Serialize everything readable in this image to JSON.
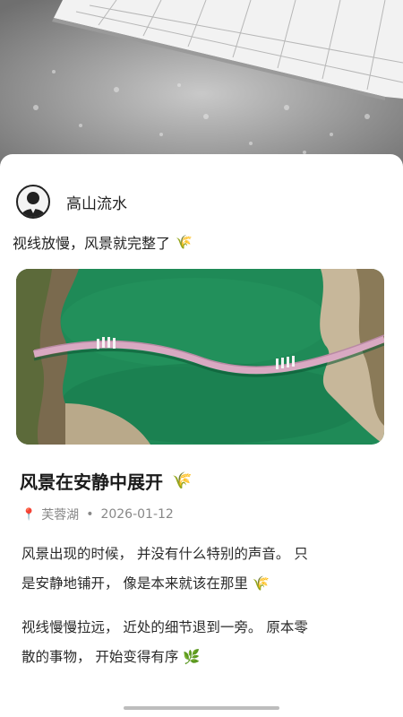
{
  "author": {
    "name": "高山流水",
    "avatar_icon": "person-avatar-icon"
  },
  "post": {
    "caption": "视线放慢，风景就完整了",
    "caption_emoji": "🌾"
  },
  "article": {
    "title": "风景在安静中展开",
    "title_emoji": "🌾",
    "location_icon": "location-pin-icon",
    "location": "芙蓉湖",
    "separator": "•",
    "date": "2026-01-12",
    "paragraphs": [
      {
        "line1": "风景出现的时候， 并没有什么特别的声音。 只",
        "line2": "是安静地铺开， 像是本来就该在那里",
        "emoji": "🌾"
      },
      {
        "line1": "视线慢慢拉远， 近处的细节退到一旁。 原本零",
        "line2": "散的事物， 开始变得有序",
        "emoji": "🌿"
      }
    ]
  },
  "colors": {
    "lake": "#1f8a57",
    "bridge": "#d9a9c2",
    "pin": "#e0463a"
  }
}
